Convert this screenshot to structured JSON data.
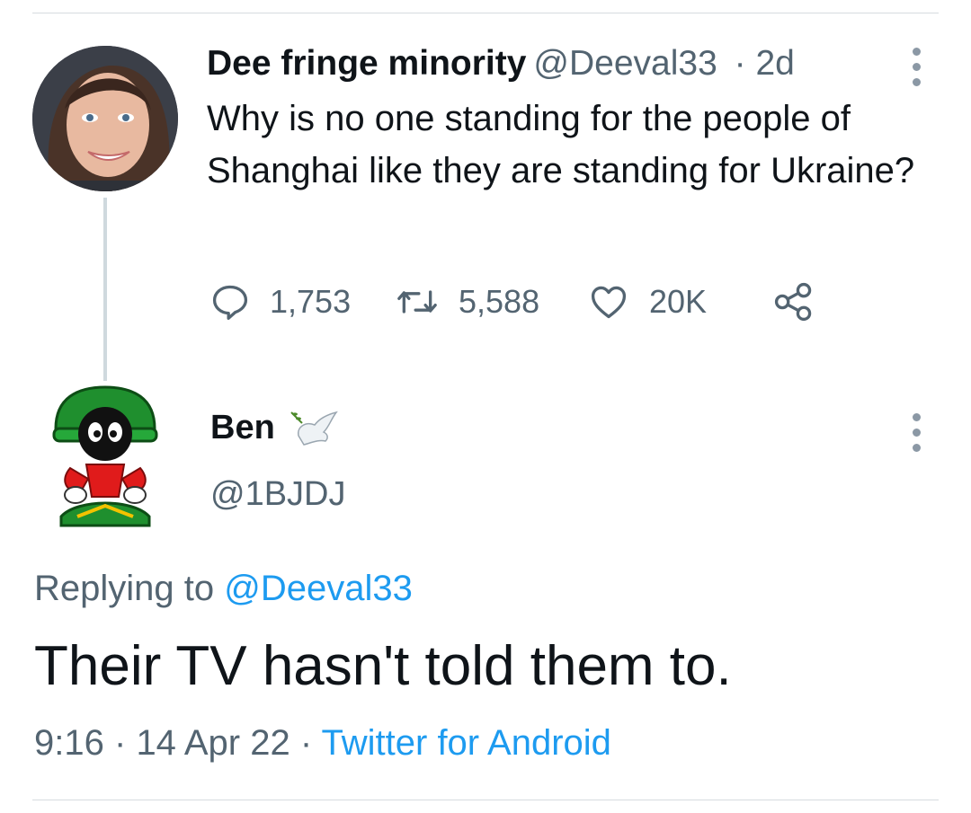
{
  "original_tweet": {
    "display_name": "Dee fringe minority",
    "handle": "@Deeval33",
    "separator": "·",
    "age": "2d",
    "text": "Why is no one standing for the people of Shanghai like they are standing for Ukraine?",
    "avatar_icon": "woman-profile-photo",
    "more_icon": "vertical-dots-icon",
    "actions": {
      "replies": "1,753",
      "retweets": "5,588",
      "likes": "20K",
      "reply_icon": "speech-bubble-icon",
      "retweet_icon": "retweet-arrows-icon",
      "like_icon": "heart-icon",
      "share_icon": "share-nodes-icon"
    }
  },
  "reply_tweet": {
    "display_name": "Ben",
    "name_emoji": "dove-with-olive-branch",
    "handle": "@1BJDJ",
    "avatar_icon": "marvin-the-martian-avatar",
    "more_icon": "vertical-dots-icon",
    "replying_prefix": "Replying to",
    "replying_to": "@Deeval33",
    "text": "Their TV hasn't told them to.",
    "time": "9:16",
    "separator": "·",
    "date": "14 Apr 22",
    "source": "Twitter for Android"
  },
  "colors": {
    "text": "#0f1419",
    "secondary": "#536471",
    "link": "#1d9bf0",
    "divider": "#d6dbdf"
  }
}
